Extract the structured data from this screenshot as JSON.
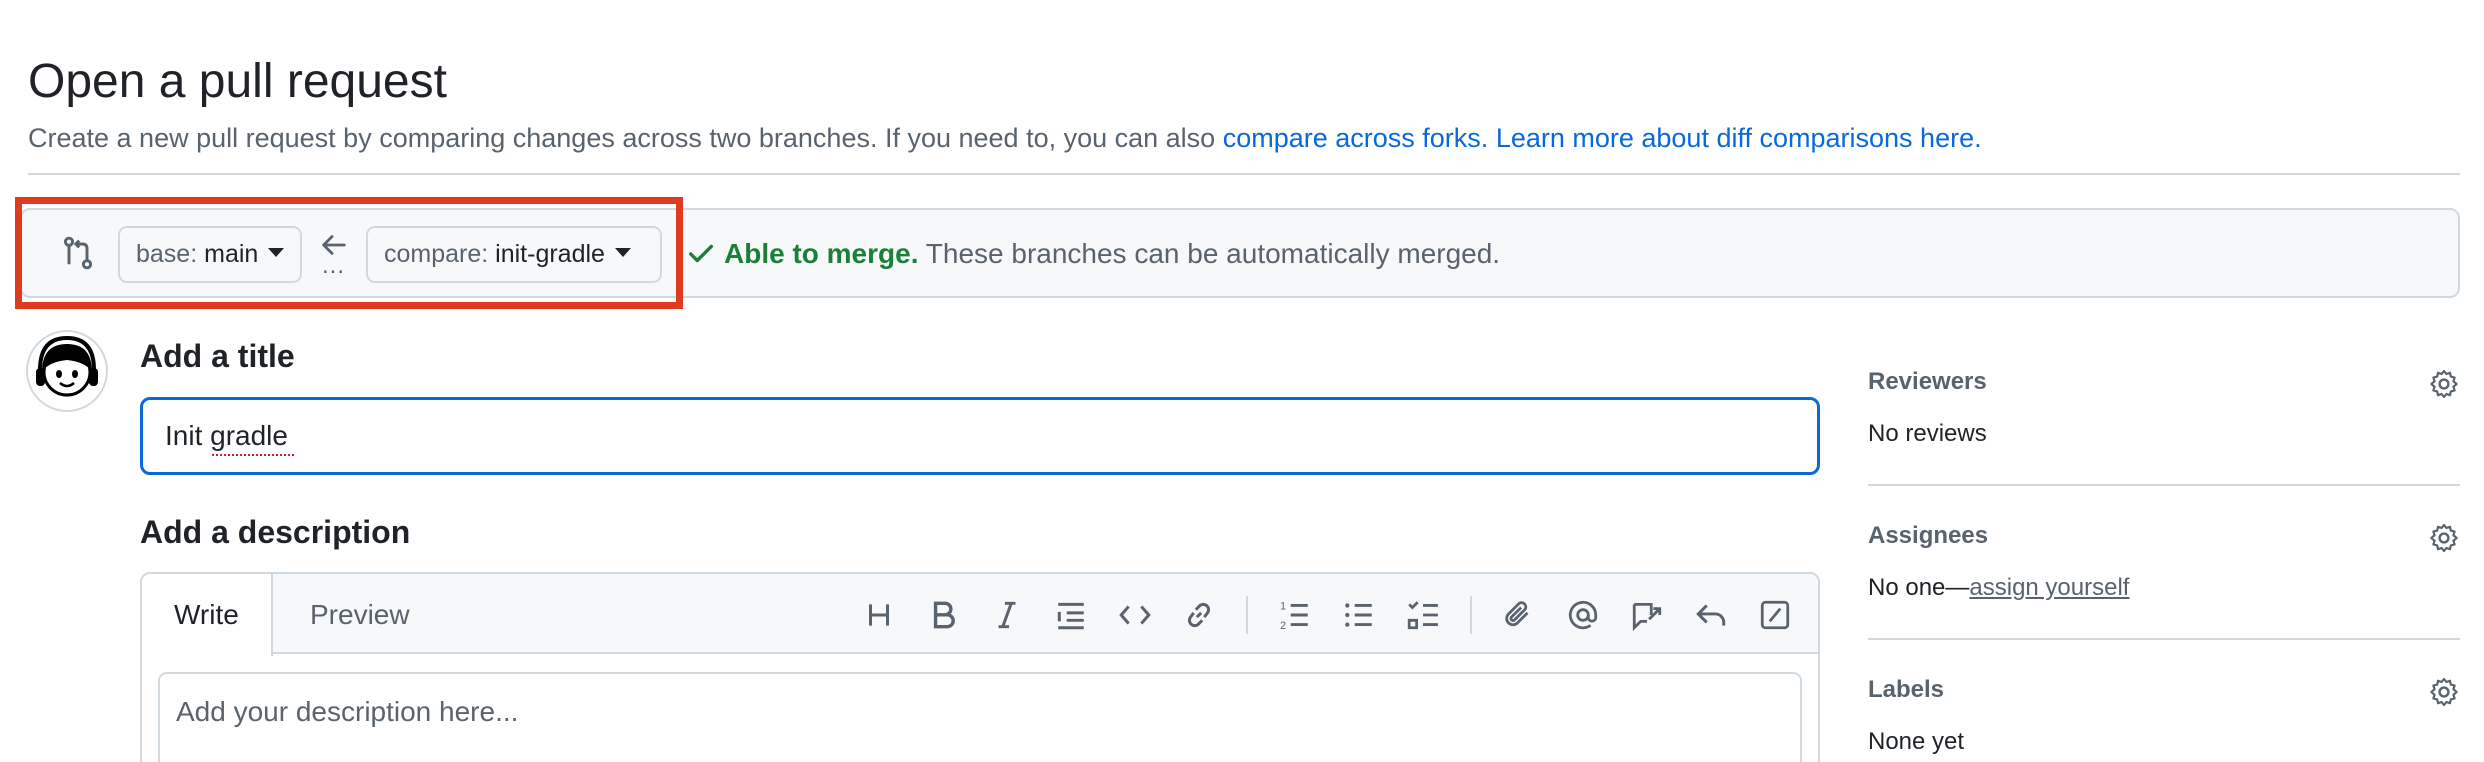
{
  "header": {
    "title": "Open a pull request",
    "subtitle_text": "Create a new pull request by comparing changes across two branches. If you need to, you can also",
    "compare_forks_link": "compare across forks.",
    "learn_more_link": "Learn more about diff comparisons here."
  },
  "range": {
    "base_prefix": "base:",
    "base_branch": "main",
    "compare_prefix": "compare:",
    "compare_branch": "init-gradle",
    "dots": "...",
    "merge_status": "Able to merge.",
    "merge_detail": "These branches can be automatically merged."
  },
  "form": {
    "title_label": "Add a title",
    "title_value": "Init gradle",
    "description_label": "Add a description",
    "tabs": [
      "Write",
      "Preview"
    ],
    "description_placeholder": "Add your description here...",
    "toolbar_icons": [
      "heading-icon",
      "bold-icon",
      "italic-icon",
      "quote-icon",
      "code-icon",
      "link-icon",
      "numbered-list-icon",
      "unordered-list-icon",
      "task-list-icon",
      "attach-icon",
      "mention-icon",
      "reference-icon",
      "reply-icon",
      "slash-command-icon"
    ]
  },
  "sidebar": {
    "reviewers": {
      "label": "Reviewers",
      "value": "No reviews"
    },
    "assignees": {
      "label": "Assignees",
      "value_prefix": "No one—",
      "value_link": "assign yourself"
    },
    "labels": {
      "label": "Labels",
      "value": "None yet"
    }
  },
  "colors": {
    "link": "#0969da",
    "success": "#1a7f37",
    "highlight": "#e03a21",
    "focus": "#0969da"
  }
}
